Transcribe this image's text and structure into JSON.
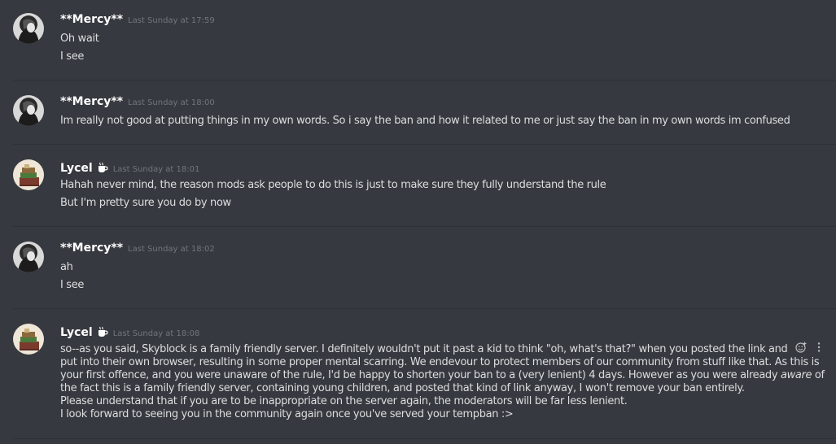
{
  "messages": [
    {
      "author": "**Mercy**",
      "timestamp": "Last Sunday at 17:59",
      "lines": [
        "Oh wait",
        "I see"
      ]
    },
    {
      "author": "**Mercy**",
      "timestamp": "Last Sunday at 18:00",
      "lines": [
        "Im really not good at putting things in my own words. So i say the ban and how it related to me or just say the ban in my own words im confused"
      ]
    },
    {
      "author": "Lycel",
      "timestamp": "Last Sunday at 18:01",
      "lines": [
        "Hahah never mind, the reason mods ask people to do this is just to make sure they fully understand the rule",
        "But I'm pretty sure you do by now"
      ]
    },
    {
      "author": "**Mercy**",
      "timestamp": "Last Sunday at 18:02",
      "lines": [
        "ah",
        "I see"
      ]
    },
    {
      "author": "Lycel",
      "timestamp": "Last Sunday at 18:08",
      "lines": [
        "so--as you said, Skyblock is a family friendly server. I definitely wouldn't put it past a kid to think \"oh, what's that?\" when you posted the link and",
        "put into their own browser, resulting in some proper mental scarring. We endevour to protect members of our community from stuff like that. As this is",
        "your first offence, and you were unaware of the rule, I'd be happy to shorten your ban to a (very lenient) 4 days. However as you were already ",
        "aware",
        " of",
        "the fact this is a family friendly server, containing young children, and posted that kind of link anyway, I won't remove your ban entirely.",
        "Please understand that if you are to be inappropriate on the server again, the moderators will be far less lenient.",
        "I look forward to seeing you in the community again once you've served your tempban :>"
      ]
    }
  ],
  "badge_icon": "coffee-cup-icon",
  "colors": {
    "background": "#36393f",
    "divider": "#2f3136",
    "username": "#ffffff",
    "timestamp": "#72767d",
    "text": "#dcddde"
  }
}
